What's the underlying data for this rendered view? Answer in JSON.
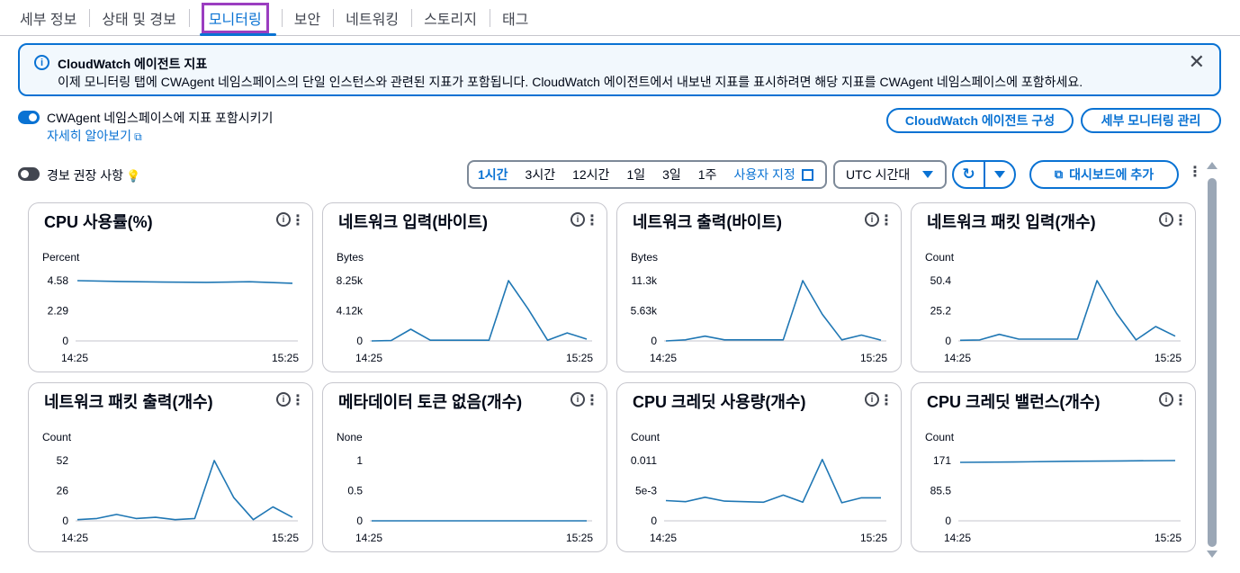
{
  "tabs": [
    {
      "label": "세부 정보",
      "active": false
    },
    {
      "label": "상태 및 경보",
      "active": false
    },
    {
      "label": "모니터링",
      "active": true
    },
    {
      "label": "보안",
      "active": false
    },
    {
      "label": "네트워킹",
      "active": false
    },
    {
      "label": "스토리지",
      "active": false
    },
    {
      "label": "태그",
      "active": false
    }
  ],
  "alert": {
    "title": "CloudWatch 에이전트 지표",
    "text": "이제 모니터링 탭에 CWAgent 네임스페이스의 단일 인스턴스와 관련된 지표가 포함됩니다. CloudWatch 에이전트에서 내보낸 지표를 표시하려면 해당 지표를 CWAgent 네임스페이스에 포함하세요.",
    "close": "✕"
  },
  "options": {
    "cwagent_label": "CWAgent 네임스페이스에 지표 포함시키기",
    "learn_more": "자세히 알아보기",
    "configure_button": "CloudWatch 에이전트 구성",
    "manage_button": "세부 모니터링 관리",
    "alarm_label": "경보 권장 사항"
  },
  "time_range": {
    "items": [
      "1시간",
      "3시간",
      "12시간",
      "1일",
      "3일",
      "1주"
    ],
    "active": "1시간",
    "custom": "사용자 지정"
  },
  "timezone": "UTC 시간대",
  "add_to_dashboard": "대시보드에 추가",
  "colors": {
    "accent": "#0972d3",
    "line": "#1f77b4"
  },
  "chart_data": [
    {
      "type": "line",
      "title": "CPU 사용률(%)",
      "ylabel": "Percent",
      "yticks": [
        "4.58",
        "2.29",
        "0"
      ],
      "ylim": [
        0,
        4.58
      ],
      "xticks": [
        "14:25",
        "15:25"
      ],
      "values": [
        4.58,
        4.52,
        4.47,
        4.45,
        4.5,
        4.38
      ]
    },
    {
      "type": "line",
      "title": "네트워크 입력(바이트)",
      "ylabel": "Bytes",
      "yticks": [
        "8.25k",
        "4.12k",
        "0"
      ],
      "ylim": [
        0,
        8250
      ],
      "xticks": [
        "14:25",
        "15:25"
      ],
      "values": [
        0,
        50,
        1600,
        100,
        100,
        100,
        100,
        8250,
        4400,
        100,
        1100,
        250
      ]
    },
    {
      "type": "line",
      "title": "네트워크 출력(바이트)",
      "ylabel": "Bytes",
      "yticks": [
        "11.3k",
        "5.63k",
        "0"
      ],
      "ylim": [
        0,
        11300
      ],
      "xticks": [
        "14:25",
        "15:25"
      ],
      "values": [
        0,
        200,
        900,
        200,
        200,
        200,
        200,
        11300,
        5000,
        200,
        1100,
        150
      ]
    },
    {
      "type": "line",
      "title": "네트워크 패킷 입력(개수)",
      "ylabel": "Count",
      "yticks": [
        "50.4",
        "25.2",
        "0"
      ],
      "ylim": [
        0,
        50.4
      ],
      "xticks": [
        "14:25",
        "15:25"
      ],
      "values": [
        0.5,
        0.8,
        5.5,
        1.5,
        1.5,
        1.5,
        1.5,
        50.4,
        23,
        0.8,
        12,
        4
      ]
    },
    {
      "type": "line",
      "title": "네트워크 패킷 출력(개수)",
      "ylabel": "Count",
      "yticks": [
        "52",
        "26",
        "0"
      ],
      "ylim": [
        0,
        52
      ],
      "xticks": [
        "14:25",
        "15:25"
      ],
      "values": [
        1,
        2,
        5.5,
        2,
        3,
        1,
        2,
        52,
        20,
        1,
        12,
        3
      ]
    },
    {
      "type": "line",
      "title": "메타데이터 토큰 없음(개수)",
      "ylabel": "None",
      "yticks": [
        "1",
        "0.5",
        "0"
      ],
      "ylim": [
        0,
        1
      ],
      "xticks": [
        "14:25",
        "15:25"
      ],
      "values": [
        0,
        0,
        0,
        0,
        0,
        0,
        0,
        0,
        0,
        0,
        0,
        0
      ]
    },
    {
      "type": "line",
      "title": "CPU 크레딧 사용량(개수)",
      "ylabel": "Count",
      "yticks": [
        "0.011",
        "5e-3",
        "0"
      ],
      "ylim": [
        0,
        0.011
      ],
      "xticks": [
        "14:25",
        "15:25"
      ],
      "values": [
        0.0037,
        0.0035,
        0.0043,
        0.0036,
        0.0035,
        0.0034,
        0.0047,
        0.0034,
        0.0112,
        0.0033,
        0.0042,
        0.0042
      ]
    },
    {
      "type": "line",
      "title": "CPU 크레딧 밸런스(개수)",
      "ylabel": "Count",
      "yticks": [
        "171",
        "85.5",
        "0"
      ],
      "ylim": [
        0,
        171
      ],
      "xticks": [
        "14:25",
        "15:25"
      ],
      "values": [
        166,
        167,
        169,
        170,
        171
      ]
    }
  ]
}
